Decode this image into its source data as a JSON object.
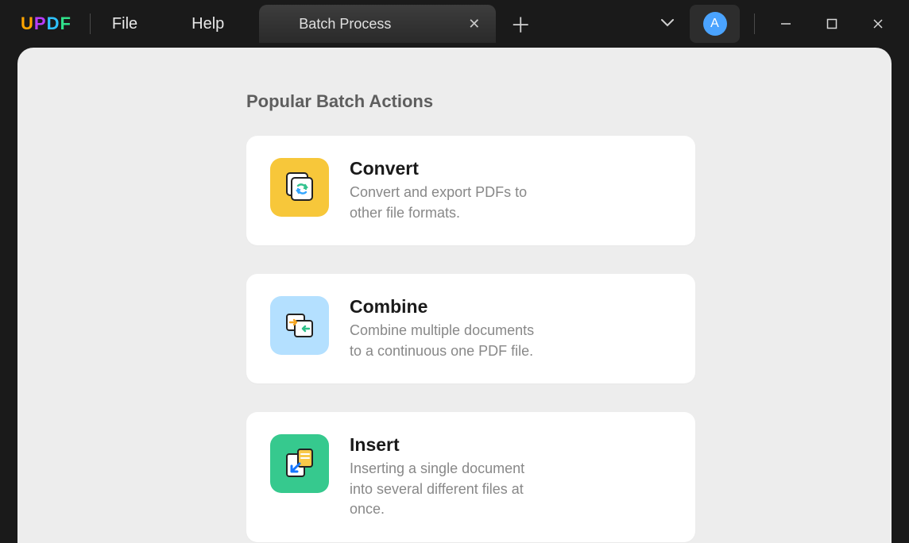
{
  "menu": {
    "file": "File",
    "help": "Help"
  },
  "tab": {
    "label": "Batch Process"
  },
  "avatar": {
    "letter": "A"
  },
  "section_title": "Popular Batch Actions",
  "cards": {
    "convert": {
      "title": "Convert",
      "desc": "Convert and export PDFs to other file formats."
    },
    "combine": {
      "title": "Combine",
      "desc": "Combine multiple documents to a continuous one PDF file."
    },
    "insert": {
      "title": "Insert",
      "desc": "Inserting a single document into several different files at once."
    }
  }
}
